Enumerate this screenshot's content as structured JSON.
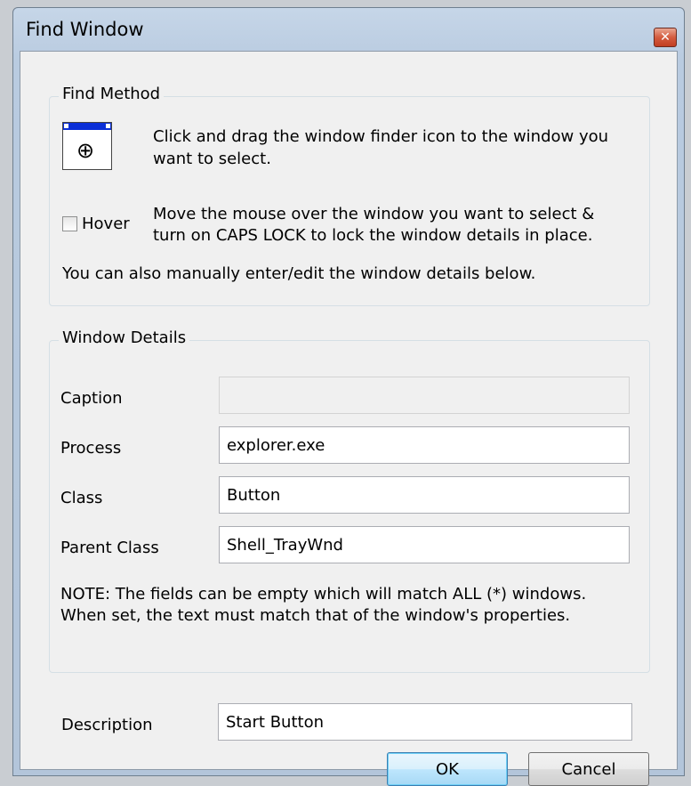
{
  "window": {
    "title": "Find Window",
    "close_glyph": "✕"
  },
  "find_method": {
    "legend": "Find Method",
    "finder_icon": "window-finder-icon",
    "drag_line1": "Click and drag the window finder icon to the window you",
    "drag_line2": "want to select.",
    "hover_label": "Hover",
    "hover_checked": false,
    "hover_line1": "Move the mouse over the window you want to select &",
    "hover_line2": "turn on CAPS LOCK to lock the window details in place.",
    "manual_text": "You can also manually enter/edit the window details below."
  },
  "window_details": {
    "legend": "Window Details",
    "caption_label": "Caption",
    "caption_value": "",
    "process_label": "Process",
    "process_value": "explorer.exe",
    "class_label": "Class",
    "class_value": "Button",
    "parent_class_label": "Parent Class",
    "parent_class_value": "Shell_TrayWnd",
    "note_line1": "NOTE: The fields can be empty which will match ALL (*) windows.",
    "note_line2": "When set, the text must match that of the window's properties."
  },
  "description": {
    "label": "Description",
    "value": "Start Button"
  },
  "buttons": {
    "ok": "OK",
    "cancel": "Cancel"
  }
}
